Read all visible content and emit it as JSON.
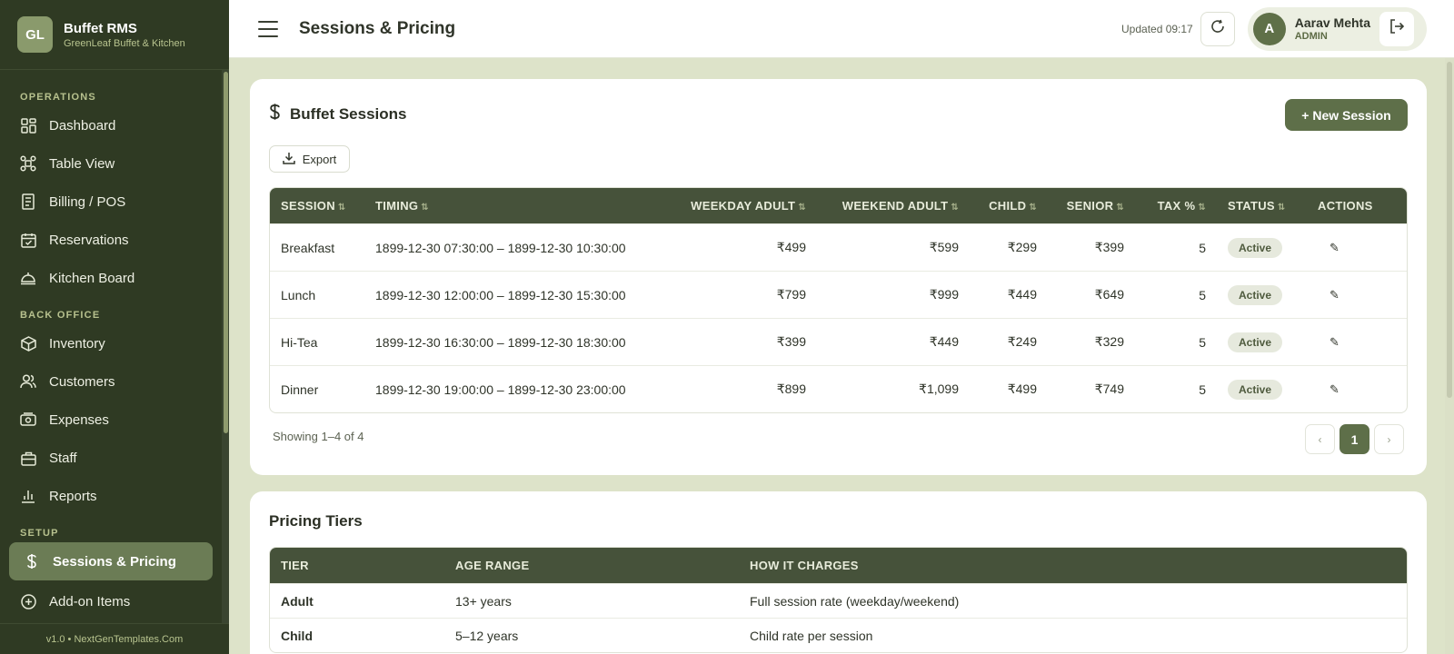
{
  "brand": {
    "logo": "GL",
    "title": "Buffet RMS",
    "subtitle": "GreenLeaf Buffet & Kitchen"
  },
  "sidebar": {
    "sections": {
      "operations": "OPERATIONS",
      "back_office": "BACK OFFICE",
      "setup": "SETUP"
    },
    "items": [
      {
        "label": "Dashboard",
        "icon": "grid-icon"
      },
      {
        "label": "Table View",
        "icon": "tables-icon"
      },
      {
        "label": "Billing / POS",
        "icon": "receipt-icon"
      },
      {
        "label": "Reservations",
        "icon": "calendar-icon"
      },
      {
        "label": "Kitchen Board",
        "icon": "cloche-icon"
      },
      {
        "label": "Inventory",
        "icon": "box-icon"
      },
      {
        "label": "Customers",
        "icon": "users-icon"
      },
      {
        "label": "Expenses",
        "icon": "wallet-icon"
      },
      {
        "label": "Staff",
        "icon": "briefcase-icon"
      },
      {
        "label": "Reports",
        "icon": "bar-chart-icon"
      },
      {
        "label": "Sessions & Pricing",
        "icon": "dollar-icon",
        "active": true
      },
      {
        "label": "Add-on Items",
        "icon": "plus-circle-icon"
      }
    ],
    "footer": "v1.0 • NextGenTemplates.Com"
  },
  "topbar": {
    "title": "Sessions & Pricing",
    "updated": "Updated 09:17",
    "user": {
      "initial": "A",
      "name": "Aarav Mehta",
      "role": "ADMIN"
    }
  },
  "sessions_card": {
    "title": "Buffet Sessions",
    "new_button": "+ New Session",
    "export_button": "Export",
    "columns": [
      "SESSION",
      "TIMING",
      "WEEKDAY ADULT",
      "WEEKEND ADULT",
      "CHILD",
      "SENIOR",
      "TAX %",
      "STATUS",
      "ACTIONS"
    ],
    "rows": [
      {
        "session": "Breakfast",
        "timing": "1899-12-30 07:30:00 – 1899-12-30 10:30:00",
        "weekday": "₹499",
        "weekend": "₹599",
        "child": "₹299",
        "senior": "₹399",
        "tax": "5",
        "status": "Active"
      },
      {
        "session": "Lunch",
        "timing": "1899-12-30 12:00:00 – 1899-12-30 15:30:00",
        "weekday": "₹799",
        "weekend": "₹999",
        "child": "₹449",
        "senior": "₹649",
        "tax": "5",
        "status": "Active"
      },
      {
        "session": "Hi-Tea",
        "timing": "1899-12-30 16:30:00 – 1899-12-30 18:30:00",
        "weekday": "₹399",
        "weekend": "₹449",
        "child": "₹249",
        "senior": "₹329",
        "tax": "5",
        "status": "Active"
      },
      {
        "session": "Dinner",
        "timing": "1899-12-30 19:00:00 – 1899-12-30 23:00:00",
        "weekday": "₹899",
        "weekend": "₹1,099",
        "child": "₹499",
        "senior": "₹749",
        "tax": "5",
        "status": "Active"
      }
    ],
    "showing": "Showing 1–4 of 4",
    "pager": {
      "prev": "‹",
      "current": "1",
      "next": "›"
    }
  },
  "pricing_card": {
    "title": "Pricing Tiers",
    "columns": [
      "TIER",
      "AGE RANGE",
      "HOW IT CHARGES"
    ],
    "rows": [
      {
        "tier": "Adult",
        "age": "13+ years",
        "charge": "Full session rate (weekday/weekend)"
      },
      {
        "tier": "Child",
        "age": "5–12 years",
        "charge": "Child rate per session"
      }
    ]
  }
}
